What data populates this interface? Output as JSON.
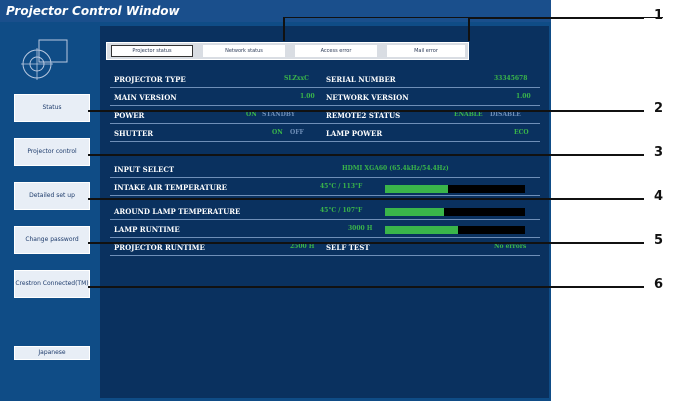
{
  "window": {
    "title": "Projector Control Window"
  },
  "nav": [
    {
      "label": "Status"
    },
    {
      "label": "Projector control"
    },
    {
      "label": "Detailed set up"
    },
    {
      "label": "Change password"
    },
    {
      "label": "Crestron Connected(TM)"
    },
    {
      "label": "Japanese"
    }
  ],
  "tabs": [
    "Projector status",
    "Network status",
    "Access error",
    "Mail error"
  ],
  "status": {
    "projector_type": {
      "label": "PROJECTOR TYPE",
      "value": "SLZxxC"
    },
    "serial_number": {
      "label": "SERIAL NUMBER",
      "value": "33345678"
    },
    "main_version": {
      "label": "MAIN VERSION",
      "value": "1.00"
    },
    "network_version": {
      "label": "NETWORK VERSION",
      "value": "1.00"
    },
    "power": {
      "label": "POWER",
      "on": "ON",
      "standby": "STANDBY"
    },
    "remote2": {
      "label": "REMOTE2 STATUS",
      "enable": "ENABLE",
      "disable": "DISABLE"
    },
    "shutter": {
      "label": "SHUTTER",
      "on": "ON",
      "off": "OFF"
    },
    "lamp_power": {
      "label": "LAMP POWER",
      "value": "ECO"
    },
    "input_select": {
      "label": "INPUT SELECT",
      "value": "HDMI XGA60 (65.4kHz/54.4Hz)"
    },
    "intake_temp": {
      "label": "INTAKE AIR TEMPERATURE",
      "value": "45°C / 113°F",
      "level": 0.45
    },
    "around_lamp_temp": {
      "label": "AROUND LAMP TEMPERATURE",
      "value": "45°C / 107°F",
      "level": 0.42
    },
    "lamp_runtime": {
      "label": "LAMP RUNTIME",
      "value": "3000 H",
      "level": 0.52
    },
    "projector_runtime": {
      "label": "PROJECTOR RUNTIME",
      "value": "2500 H"
    },
    "self_test": {
      "label": "SELF TEST",
      "value": "No errors"
    }
  },
  "callouts": [
    "1",
    "2",
    "3",
    "4",
    "5",
    "6"
  ]
}
